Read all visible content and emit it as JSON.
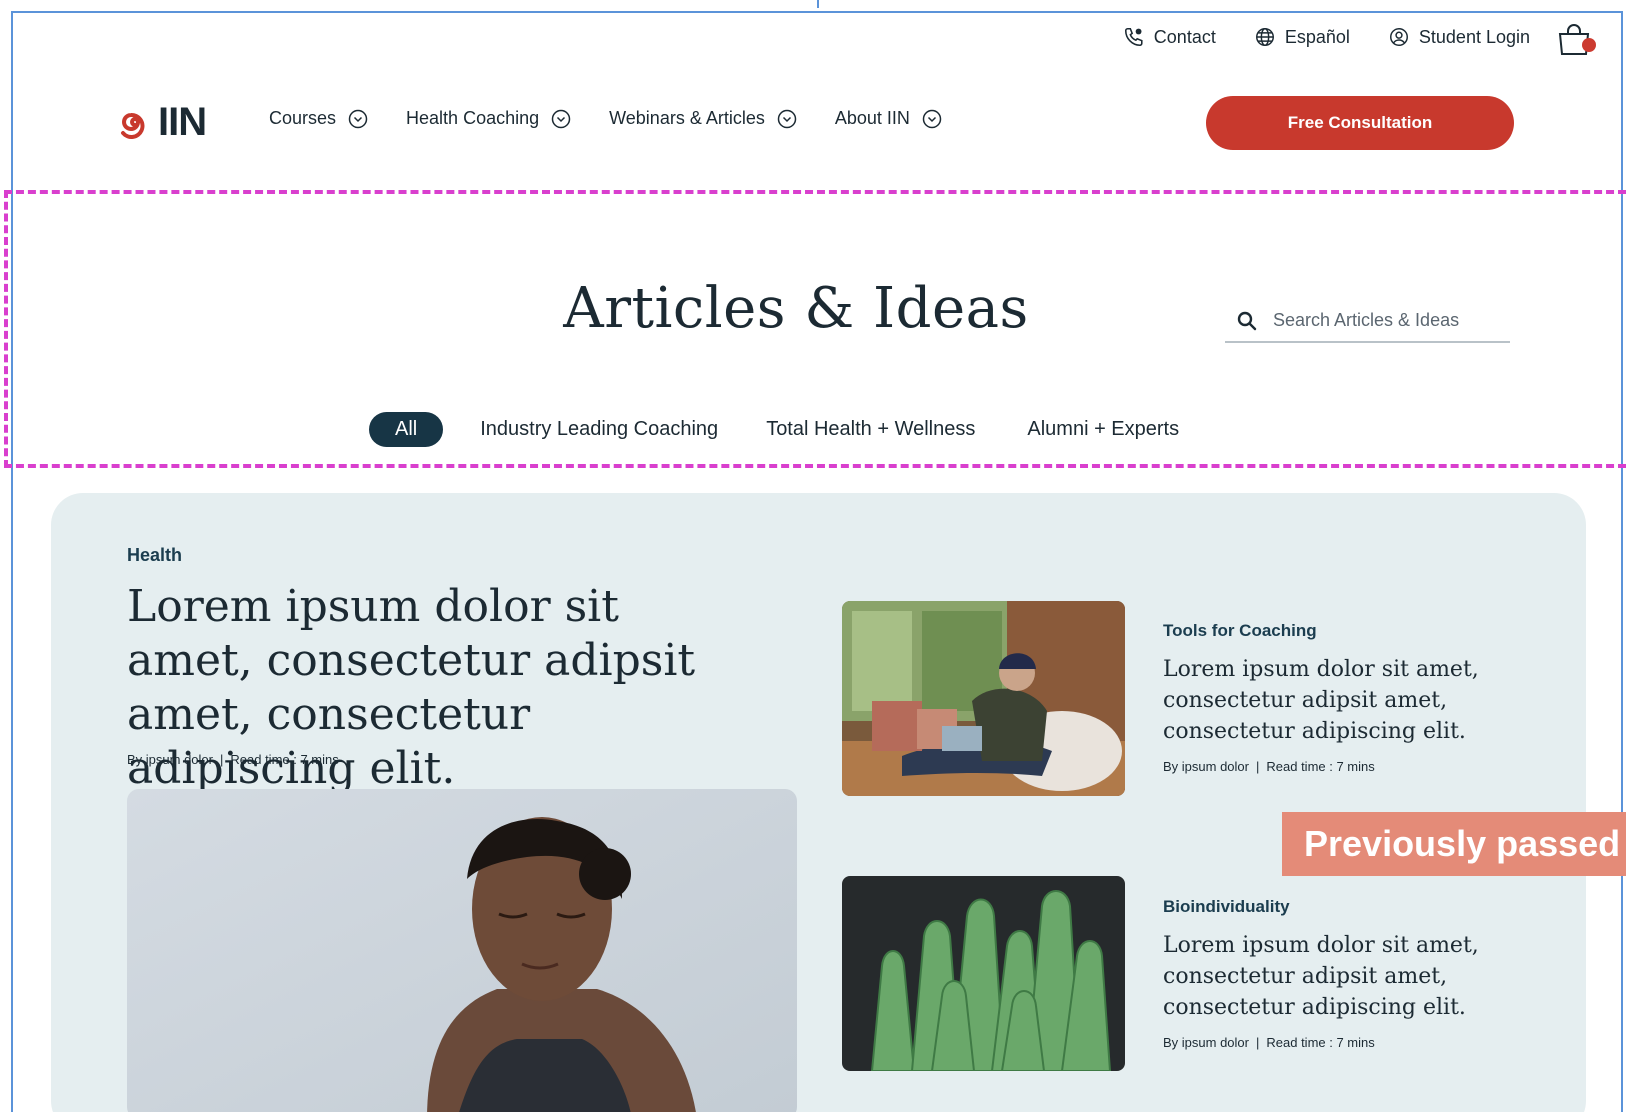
{
  "utility": {
    "contact": "Contact",
    "language": "Español",
    "login": "Student Login"
  },
  "logo": {
    "text": "IIN"
  },
  "nav": {
    "items": [
      {
        "label": "Courses"
      },
      {
        "label": "Health Coaching"
      },
      {
        "label": "Webinars & Articles"
      },
      {
        "label": "About IIN"
      }
    ],
    "cta": "Free Consultation"
  },
  "page": {
    "title": "Articles & Ideas",
    "search_placeholder": "Search Articles & Ideas"
  },
  "filters": [
    "All",
    "Industry Leading Coaching",
    "Total Health + Wellness",
    "Alumni + Experts"
  ],
  "featured": {
    "category": "Health",
    "title": "Lorem ipsum dolor sit amet, consectetur adipsit amet, consectetur adipiscing elit.",
    "author": "By ipsum dolor",
    "read_time": "Read time : 7 mins"
  },
  "side_articles": [
    {
      "category": "Tools for Coaching",
      "title": "Lorem ipsum dolor sit amet, consectetur adipsit amet, consectetur adipiscing elit.",
      "author": "By ipsum dolor",
      "read_time": "Read time : 7 mins"
    },
    {
      "category": "Bioindividuality",
      "title": "Lorem ipsum dolor sit amet, consectetur adipsit amet, consectetur adipiscing elit.",
      "author": "By ipsum dolor",
      "read_time": "Read time : 7 mins"
    }
  ],
  "overlay_badge": "Previously passed",
  "colors": {
    "accent": "#c8392d",
    "navy": "#173545",
    "panel": "#e5eef0",
    "selection": "#d93fce",
    "badge": "#e48b78"
  }
}
